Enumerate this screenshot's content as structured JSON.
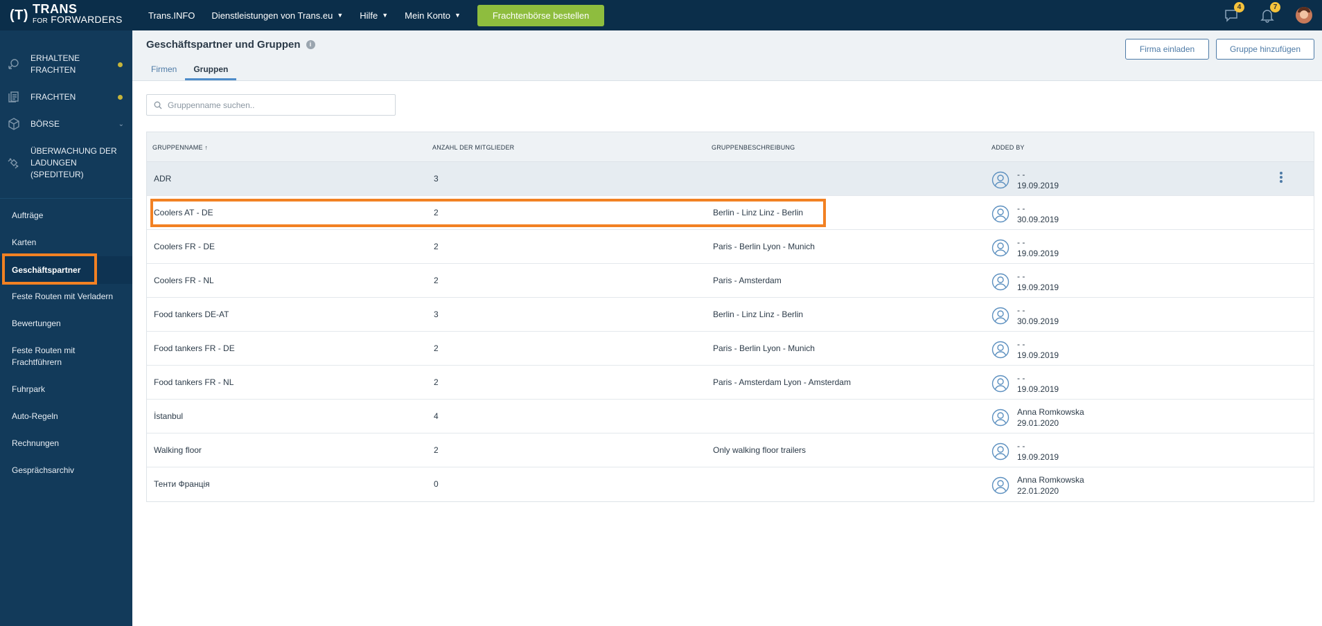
{
  "brand": {
    "mark": "(T)",
    "line1": "TRANS",
    "line2_small": "FOR",
    "line2": "FORWARDERS"
  },
  "topbar": {
    "links": [
      {
        "label": "Trans.INFO",
        "dropdown": false
      },
      {
        "label": "Dienstleistungen von Trans.eu",
        "dropdown": true
      },
      {
        "label": "Hilfe",
        "dropdown": true
      },
      {
        "label": "Mein Konto",
        "dropdown": true
      }
    ],
    "cta": "Frachtenbörse bestellen",
    "messages_badge": "4",
    "notifications_badge": "7"
  },
  "sidebar": {
    "modules": [
      {
        "label": "ERHALTENE FRACHTEN",
        "icon": "received-freight-icon",
        "dot": true
      },
      {
        "label": "FRACHTEN",
        "icon": "freight-icon",
        "dot": true
      },
      {
        "label": "BÖRSE",
        "icon": "exchange-box-icon",
        "chevron": true
      },
      {
        "label": "ÜBERWACHUNG DER LADUNGEN (SPEDITEUR)",
        "icon": "satellite-icon"
      }
    ],
    "items": [
      {
        "label": "Aufträge"
      },
      {
        "label": "Karten"
      },
      {
        "label": "Geschäftspartner",
        "active": true
      },
      {
        "label": "Feste Routen mit Verladern"
      },
      {
        "label": "Bewertungen"
      },
      {
        "label": "Feste Routen mit Frachtführern"
      },
      {
        "label": "Fuhrpark"
      },
      {
        "label": "Auto-Regeln"
      },
      {
        "label": "Rechnungen"
      },
      {
        "label": "Gesprächsarchiv"
      }
    ]
  },
  "header": {
    "title": "Geschäftspartner und Gruppen",
    "tabs": [
      {
        "label": "Firmen"
      },
      {
        "label": "Gruppen",
        "active": true
      }
    ],
    "invite_button": "Firma einladen",
    "add_group_button": "Gruppe hinzufügen"
  },
  "search": {
    "placeholder": "Gruppenname suchen..",
    "value": ""
  },
  "table": {
    "headers": [
      "GRUPPENNAME ↑",
      "ANZAHL DER MITGLIEDER",
      "GRUPPENBESCHREIBUNG",
      "ADDED BY"
    ],
    "rows": [
      {
        "name": "ADR",
        "members": "3",
        "description": "",
        "added_by": "- -",
        "date": "19.09.2019"
      },
      {
        "name": "Coolers AT - DE",
        "members": "2",
        "description": "Berlin - Linz Linz - Berlin",
        "added_by": "- -",
        "date": "30.09.2019"
      },
      {
        "name": "Coolers FR - DE",
        "members": "2",
        "description": "Paris - Berlin Lyon - Munich",
        "added_by": "- -",
        "date": "19.09.2019"
      },
      {
        "name": "Coolers FR - NL",
        "members": "2",
        "description": "Paris - Amsterdam",
        "added_by": "- -",
        "date": "19.09.2019"
      },
      {
        "name": "Food tankers DE-AT",
        "members": "3",
        "description": "Berlin - Linz Linz - Berlin",
        "added_by": "- -",
        "date": "30.09.2019"
      },
      {
        "name": "Food tankers FR - DE",
        "members": "2",
        "description": "Paris - Berlin Lyon - Munich",
        "added_by": "- -",
        "date": "19.09.2019"
      },
      {
        "name": "Food tankers FR - NL",
        "members": "2",
        "description": "Paris - Amsterdam Lyon - Amsterdam",
        "added_by": "- -",
        "date": "19.09.2019"
      },
      {
        "name": "İstanbul",
        "members": "4",
        "description": "",
        "added_by": "Anna Romkowska",
        "date": "29.01.2020"
      },
      {
        "name": "Walking floor",
        "members": "2",
        "description": "Only walking floor trailers",
        "added_by": "- -",
        "date": "19.09.2019"
      },
      {
        "name": "Тенти Франція",
        "members": "0",
        "description": "",
        "added_by": "Anna Romkowska",
        "date": "22.01.2020"
      }
    ]
  },
  "colors": {
    "sidebar": "#123a5a",
    "topbar": "#0b2e4a",
    "cta": "#8ebd3e",
    "highlight": "#f28123",
    "accent": "#4d7aa6"
  }
}
